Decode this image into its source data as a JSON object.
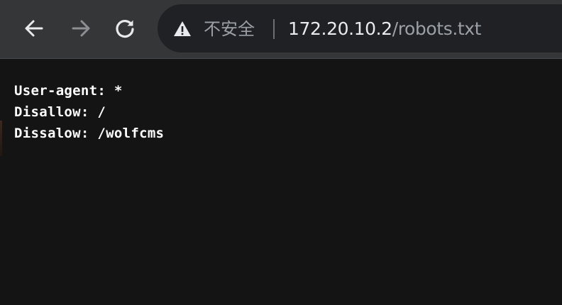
{
  "toolbar": {
    "back_icon": "arrow-left-icon",
    "forward_icon": "arrow-right-icon",
    "reload_icon": "reload-icon",
    "colors": {
      "toolbar_bg": "#353638",
      "omnibox_bg": "#202124",
      "icon_active": "#e8eaed",
      "icon_disabled": "#8c8f93"
    }
  },
  "omnibox": {
    "security_icon": "warning-triangle-icon",
    "security_text": "不安全",
    "url_host": "172.20.10.2",
    "url_path": "/robots.txt"
  },
  "page": {
    "background": "#141414",
    "lines": [
      "User-agent: *",
      "Disallow: /",
      "Dissalow: /wolfcms"
    ]
  }
}
